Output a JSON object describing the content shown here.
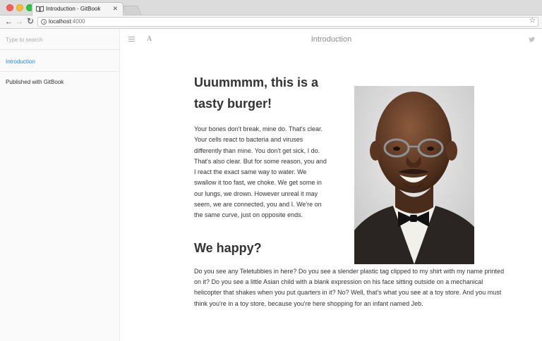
{
  "browser": {
    "tab_title": "Introduction · GitBook",
    "url_host": "localhost",
    "url_port": ":4000"
  },
  "sidebar": {
    "search_placeholder": "Type to search",
    "items": [
      {
        "label": "Introduction",
        "active": true
      },
      {
        "label": "Published with GitBook"
      }
    ]
  },
  "header": {
    "title": "Introduction"
  },
  "content": {
    "heading1": "Uuummmm, this is a tasty burger!",
    "paragraph1": "Your bones don't break, mine do. That's clear. Your cells react to bacteria and viruses differently than mine. You don't get sick, I do. That's also clear. But for some reason, you and I react the exact same way to water. We swallow it too fast, we choke. We get some in our lungs, we drown. However unreal it may seem, we are connected, you and I. We're on the same curve, just on opposite ends.",
    "heading2": "We happy?",
    "paragraph2": "Do you see any Teletubbies in here? Do you see a slender plastic tag clipped to my shirt with my name printed on it? Do you see a little Asian child with a blank expression on his face sitting outside on a mechanical helicopter that shakes when you put quarters in it? No? Well, that's what you see at a toy store. And you must think you're in a toy store, because you're here shopping for an infant named Jeb."
  },
  "colors": {
    "link_active": "#1e88e5",
    "text": "#333333",
    "sidebar_bg": "#fafafa"
  }
}
